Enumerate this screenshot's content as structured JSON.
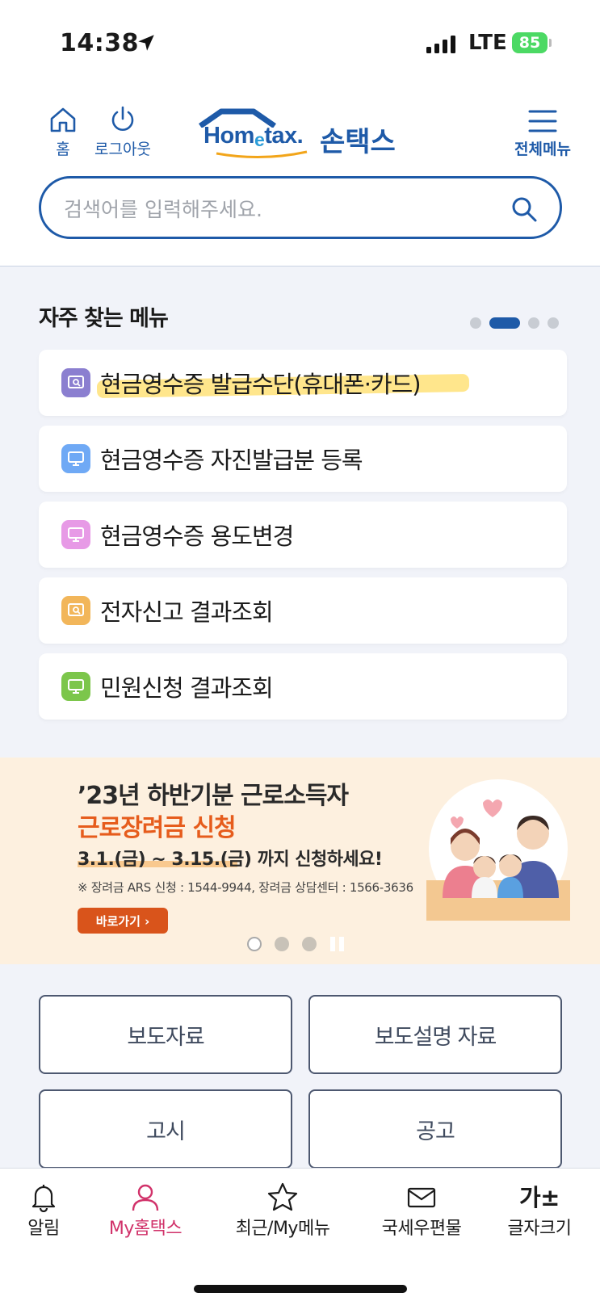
{
  "status": {
    "time": "14:38",
    "network": "LTE",
    "battery": "85"
  },
  "header": {
    "home_label": "홈",
    "logout_label": "로그아웃",
    "menu_label": "전체메뉴",
    "logo_brand": "Hom",
    "logo_brand_e": "e",
    "logo_brand_tail": "tax.",
    "logo_kor": "손택스"
  },
  "search": {
    "placeholder": "검색어를 입력해주세요.",
    "value": ""
  },
  "frequent": {
    "title": "자주 찾는 메뉴",
    "page_count": 4,
    "active_page": 2,
    "items": [
      {
        "label": "현금영수증 발급수단(휴대폰·카드)",
        "icon": "receipt-search-icon",
        "color": "#8b7fd0"
      },
      {
        "label": "현금영수증 자진발급분 등록",
        "icon": "monitor-icon",
        "color": "#6fa9f5"
      },
      {
        "label": "현금영수증 용도변경",
        "icon": "monitor-icon",
        "color": "#e79ae6"
      },
      {
        "label": "전자신고 결과조회",
        "icon": "receipt-search-icon",
        "color": "#f2b65a"
      },
      {
        "label": "민원신청 결과조회",
        "icon": "monitor-icon",
        "color": "#7cc64b"
      }
    ]
  },
  "banner": {
    "line1": "’23년 하반기분 근로소득자",
    "line2": "근로장려금 신청",
    "line3": "3.1.(금) ~ 3.15.(금) 까지 신청하세요!",
    "note": "※ 장려금 ARS 신청 : 1544-9944, 장려금 상담센터 : 1566-3636",
    "button": "바로가기 ›"
  },
  "info_buttons": [
    "보도자료",
    "보도설명 자료",
    "고시",
    "공고"
  ],
  "tabs": [
    {
      "label": "알림",
      "icon": "bell-icon"
    },
    {
      "label": "My홈택스",
      "icon": "person-icon",
      "active": true
    },
    {
      "label": "최근/My메뉴",
      "icon": "star-icon"
    },
    {
      "label": "국세우편물",
      "icon": "mail-icon"
    },
    {
      "label": "글자크기",
      "icon": "font-size-icon",
      "glyph": "가±"
    }
  ],
  "colors": {
    "brand": "#1e5aa8",
    "accent": "#d1326a",
    "banner_bg": "#fdf0df",
    "banner_orange": "#e65c1c"
  }
}
